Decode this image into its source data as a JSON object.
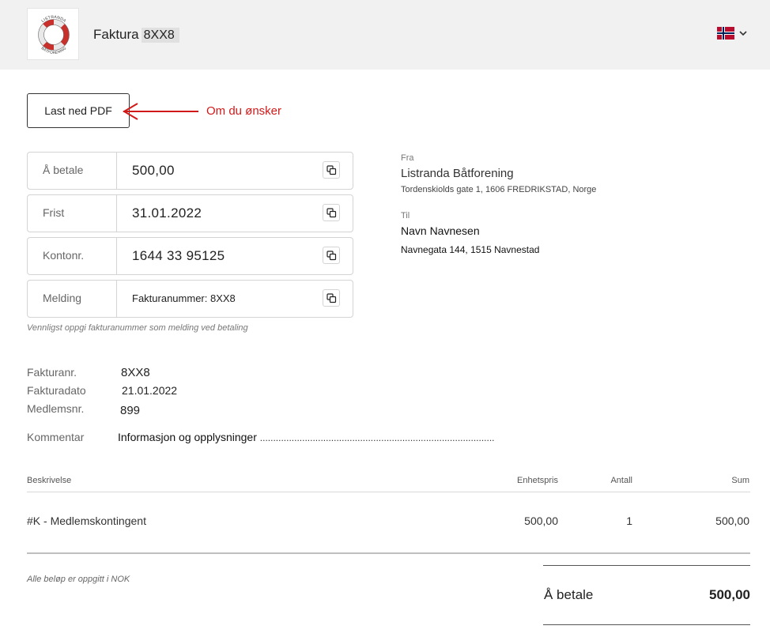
{
  "header": {
    "logo_top_text": "LISTRANDA",
    "logo_bottom_text": "BÅTFORENING",
    "title_word": "Faktura",
    "title_number": "8XX8",
    "language": "Norwegian flag"
  },
  "download_button": "Last ned PDF",
  "annotation": "Om du ønsker",
  "payment": [
    {
      "label": "Å betale",
      "value": "500,00"
    },
    {
      "label": "Frist",
      "value": "31.01.2022"
    },
    {
      "label": "Kontonr.",
      "value": "1644 33 95125"
    },
    {
      "label": "Melding",
      "value": "Fakturanummer: 8XX8"
    }
  ],
  "payment_hint": "Vennligst oppgi fakturanummer som melding ved betaling",
  "from": {
    "label": "Fra",
    "name": "Listranda Båtforening",
    "address": "Tordenskiolds gate 1, 1606 FREDRIKSTAD, Norge"
  },
  "to": {
    "label": "Til",
    "name": "Navn Navnesen",
    "address": "Navnegata 144, 1515 Navnestad"
  },
  "meta": [
    {
      "label": "Fakturanr.",
      "value": "8XX8"
    },
    {
      "label": "Fakturadato",
      "value": "21.01.2022"
    },
    {
      "label": "Medlemsnr.",
      "value": "899"
    }
  ],
  "comment": {
    "label": "Kommentar",
    "text": "Informasjon og opplysninger",
    "dots": "........................................................................................."
  },
  "table": {
    "headers": {
      "description": "Beskrivelse",
      "unit_price": "Enhetspris",
      "quantity": "Antall",
      "sum": "Sum"
    },
    "rows": [
      {
        "description": "#K - Medlemskontingent",
        "unit_price": "500,00",
        "quantity": "1",
        "sum": "500,00"
      }
    ]
  },
  "currency_note": "Alle beløp er oppgitt i NOK",
  "total": {
    "label": "Å betale",
    "value": "500,00"
  },
  "colors": {
    "annotation_red": "#d01a1a",
    "header_bg": "#f1f1f1",
    "flag_red": "#ba0c2f",
    "flag_blue": "#00205b"
  }
}
